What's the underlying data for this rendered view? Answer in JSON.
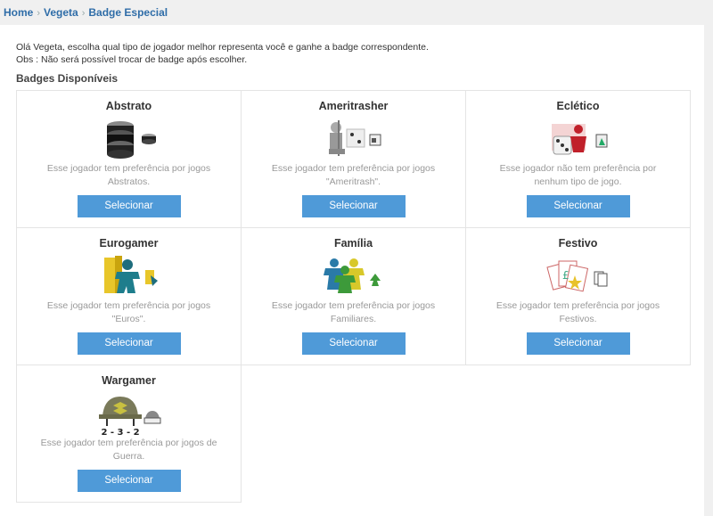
{
  "breadcrumb": [
    "Home",
    "Vegeta",
    "Badge Especial"
  ],
  "intro": {
    "line1": "Olá Vegeta, escolha qual tipo de jogador melhor representa você e ganhe a badge correspondente.",
    "line2": "Obs : Não será possível trocar de badge após escolher."
  },
  "section_title": "Badges Disponíveis",
  "badges": [
    {
      "title": "Abstrato",
      "description": "Esse jogador tem preferência por jogos Abstratos.",
      "button": "Selecionar",
      "icon": "abstrato-icon"
    },
    {
      "title": "Ameritrasher",
      "description": "Esse jogador tem preferência por jogos \"Ameritrash\".",
      "button": "Selecionar",
      "icon": "ameritrasher-icon"
    },
    {
      "title": "Eclético",
      "description": "Esse jogador não tem preferência por nenhum tipo de jogo.",
      "button": "Selecionar",
      "icon": "ecletico-icon"
    },
    {
      "title": "Eurogamer",
      "description": "Esse jogador tem preferência por jogos \"Euros\".",
      "button": "Selecionar",
      "icon": "eurogamer-icon"
    },
    {
      "title": "Família",
      "description": "Esse jogador tem preferência por jogos Familiares.",
      "button": "Selecionar",
      "icon": "familia-icon"
    },
    {
      "title": "Festivo",
      "description": "Esse jogador tem preferência por jogos Festivos.",
      "button": "Selecionar",
      "icon": "festivo-icon"
    },
    {
      "title": "Wargamer",
      "description": "Esse jogador tem preferência por jogos de Guerra.",
      "button": "Selecionar",
      "icon": "wargamer-icon",
      "icon_text": "2 - 3 - 2"
    }
  ],
  "colors": {
    "link": "#2f6da8",
    "button": "#4f9ad8"
  }
}
